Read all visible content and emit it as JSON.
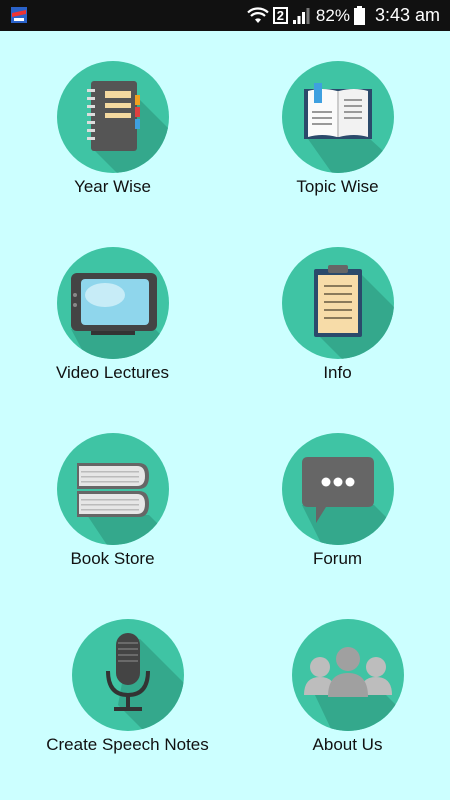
{
  "status_bar": {
    "battery_percent": "82%",
    "time": "3:43 am",
    "sim_slot": "2"
  },
  "menu": {
    "items": [
      {
        "label": "Year Wise",
        "icon": "notebook-icon"
      },
      {
        "label": "Topic Wise",
        "icon": "open-book-icon"
      },
      {
        "label": "Video Lectures",
        "icon": "tv-icon"
      },
      {
        "label": "Info",
        "icon": "clipboard-icon"
      },
      {
        "label": "Book Store",
        "icon": "books-stack-icon"
      },
      {
        "label": "Forum",
        "icon": "chat-bubble-icon"
      },
      {
        "label": "Create Speech Notes",
        "icon": "microphone-icon"
      },
      {
        "label": "About Us",
        "icon": "group-people-icon"
      }
    ]
  },
  "colors": {
    "background": "#ccffff",
    "circle": "#3fc4a4",
    "status_bar": "#111111"
  }
}
